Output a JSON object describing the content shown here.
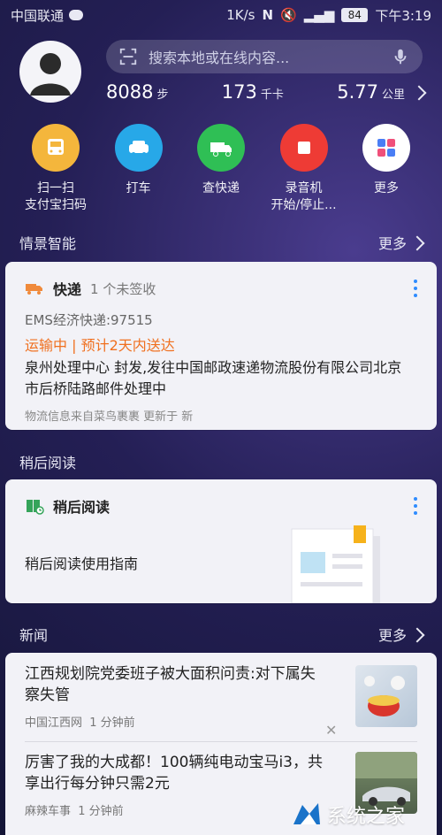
{
  "status": {
    "carrier": "中国联通",
    "speed": "1K/s",
    "battery": "84",
    "time": "下午3:19"
  },
  "search": {
    "placeholder": "搜索本地或在线内容..."
  },
  "stats": {
    "steps": {
      "value": "8088",
      "unit": "步"
    },
    "calories": {
      "value": "173",
      "unit": "千卡"
    },
    "distance": {
      "value": "5.77",
      "unit": "公里"
    }
  },
  "quick_actions": [
    {
      "label_line1": "扫一扫",
      "label_line2": "支付宝扫码",
      "color": "#f4b63c"
    },
    {
      "label_line1": "打车",
      "label_line2": "",
      "color": "#27a8e8"
    },
    {
      "label_line1": "查快递",
      "label_line2": "",
      "color": "#2fbf55"
    },
    {
      "label_line1": "录音机",
      "label_line2": "开始/停止...",
      "color": "#ee3b35"
    },
    {
      "label_line1": "更多",
      "label_line2": "",
      "color": "#ffffff"
    }
  ],
  "sections": {
    "scene": {
      "title": "情景智能",
      "more": "更多"
    },
    "read_later": {
      "title": "稍后阅读"
    },
    "news": {
      "title": "新闻",
      "more": "更多"
    }
  },
  "express": {
    "title": "快递",
    "subtitle": "1 个未签收",
    "tracking": "EMS经济快递:97515",
    "status": "运输中 | 预计2天内送达",
    "detail": "泉州处理中心 封发,发往中国邮政速递物流股份有限公司北京市后桥陆路邮件处理中",
    "source": "物流信息来自菜鸟裹裹 更新于 新"
  },
  "read_later_card": {
    "title": "稍后阅读",
    "guide": "稍后阅读使用指南"
  },
  "news": [
    {
      "title": "江西规划院党委班子被大面积问责:对下属失察失管",
      "source": "中国江西网",
      "time": "1 分钟前"
    },
    {
      "title": "厉害了我的大成都！100辆纯电动宝马i3，共享出行每分钟只需2元",
      "source": "麻辣车事",
      "time": "1 分钟前"
    }
  ],
  "watermark": {
    "text": "系统之家",
    "domain": "XITONGZHIJIA.NET"
  }
}
